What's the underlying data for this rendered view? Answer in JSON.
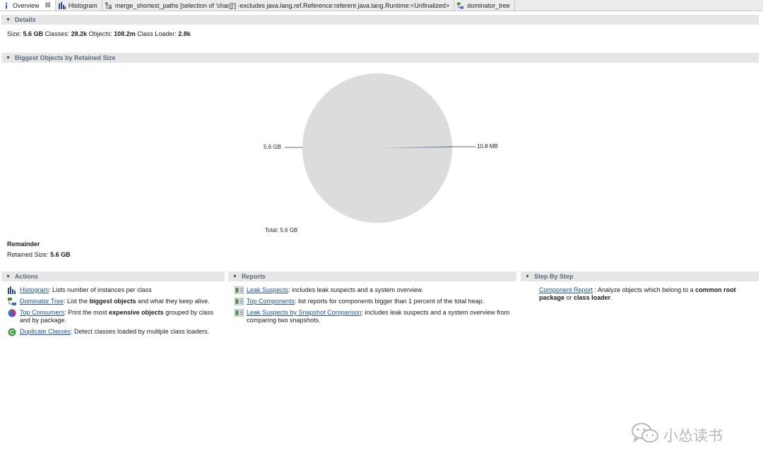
{
  "tabs": [
    {
      "label": "Overview",
      "active": true,
      "icon": "info-icon",
      "closable": true
    },
    {
      "label": "Histogram",
      "icon": "histogram-icon"
    },
    {
      "label": "merge_shortest_paths  [selection of 'char[]'] -excludes java.lang.ref.Reference:referent java.lang.Runtime:<Unfinalized>",
      "icon": "tree-icon"
    },
    {
      "label": "dominator_tree",
      "icon": "dominator-tree-icon"
    }
  ],
  "details": {
    "title": "Details",
    "size_label": "Size:",
    "size_value": "5.6 GB",
    "classes_label": "Classes:",
    "classes_value": "28.2k",
    "objects_label": "Objects:",
    "objects_value": "108.2m",
    "loader_label": "Class Loader:",
    "loader_value": "2.8k"
  },
  "biggest": {
    "title": "Biggest Objects by Retained Size",
    "left_label": "5.6 GB",
    "right_label": "10.8 MB",
    "total_label": "Total: 5.6 GB",
    "remainder_title": "Remainder",
    "retained_label": "Retained Size:",
    "retained_value": "5.6 GB",
    "colors": {
      "remainder": "#dcdcdc",
      "slice": "#6f8aa3"
    }
  },
  "chart_data": {
    "type": "pie",
    "labels": [
      "5.6 GB",
      "10.8 MB"
    ],
    "values_mb": [
      5734.4,
      10.8
    ],
    "total": "Total: 5.6 GB"
  },
  "actions": {
    "title": "Actions",
    "items": [
      {
        "link": "Histogram",
        "text": ": Lists number of instances per class",
        "icon": "histogram-icon"
      },
      {
        "link": "Dominator Tree",
        "pre": ": List the ",
        "bold": "biggest objects",
        "post": " and what they keep alive.",
        "icon": "dominator-tree-icon"
      },
      {
        "link": "Top Consumers",
        "pre": ": Print the most ",
        "bold": "expensive objects",
        "post": " grouped by class and by package.",
        "icon": "top-consumers-icon"
      },
      {
        "link": "Duplicate Classes",
        "text": ": Detect classes loaded by multiple class loaders.",
        "icon": "duplicate-classes-icon"
      }
    ]
  },
  "reports": {
    "title": "Reports",
    "items": [
      {
        "link": "Leak Suspects",
        "text": ": includes leak suspects and a system overview.",
        "icon": "report-icon"
      },
      {
        "link": "Top Components",
        "text": ": list reports for components bigger than 1 percent of the total heap.",
        "icon": "report-icon"
      },
      {
        "link": "Leak Suspects by Snapshot Comparison",
        "text": ": includes leak suspects and a system overview from comparing two snapshots.",
        "icon": "report-icon"
      }
    ]
  },
  "step": {
    "title": "Step By Step",
    "link": "Component Report",
    "pre": " : Analyze objects which belong to a ",
    "bold1": "common root package",
    "mid": " or ",
    "bold2": "class loader",
    "post": "."
  },
  "watermark": {
    "text": "小怂读书",
    "icon": "wechat-icon"
  }
}
